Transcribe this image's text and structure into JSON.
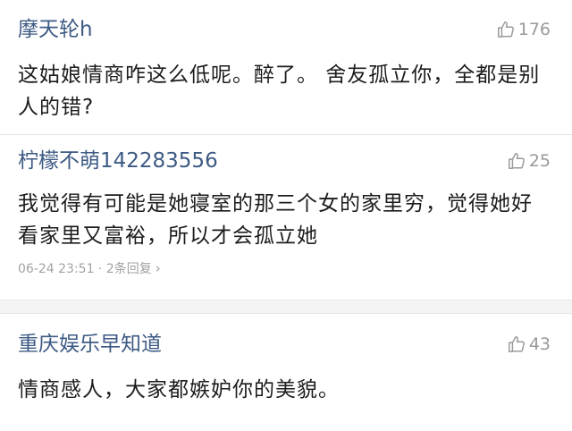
{
  "comments": [
    {
      "username": "摩天轮h",
      "likes": "176",
      "text": "这姑娘情商咋这么低呢。醉了。 舍友孤立你，全都是别人的错?"
    },
    {
      "username": "柠檬不萌142283556",
      "likes": "25",
      "text": "我觉得有可能是她寝室的那三个女的家里穷，觉得她好看家里又富裕，所以才会孤立她",
      "meta": "06-24 23:51 · 2条回复",
      "chevron": "›"
    },
    {
      "username": "重庆娱乐早知道",
      "likes": "43",
      "text": "情商感人，大家都嫉妒你的美貌。"
    }
  ],
  "icons": {
    "like": "thumbs-up-icon"
  },
  "colors": {
    "username": "#3d5a84",
    "text": "#1c1c1c",
    "muted": "#9a9a9a"
  }
}
